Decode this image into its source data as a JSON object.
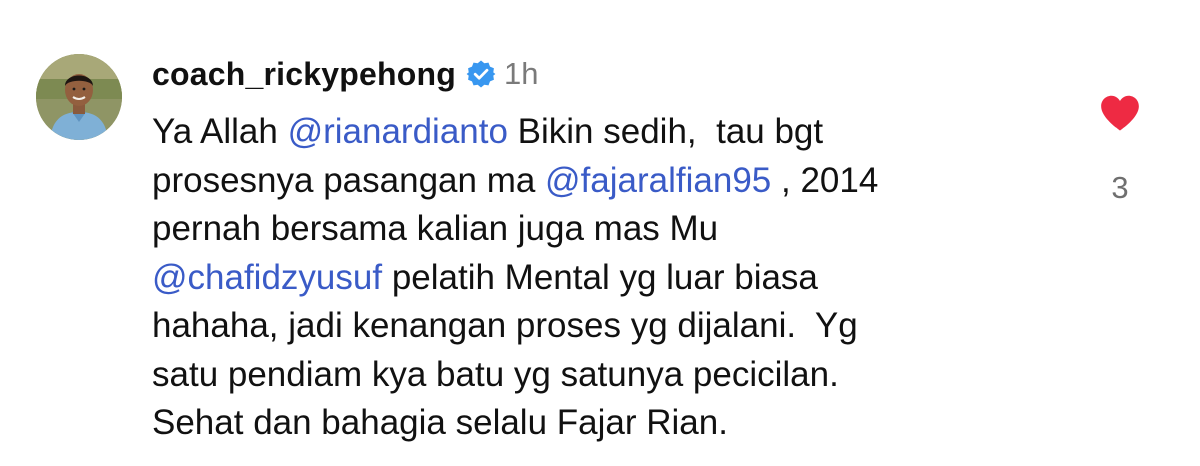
{
  "comment": {
    "username": "coach_rickypehong",
    "verified": true,
    "time": "1h",
    "body": {
      "line1": {
        "pre": "Ya Allah ",
        "mention": "@rianardianto",
        "post": " Bikin sedih,  tau bgt"
      },
      "line2": {
        "pre": "prosesnya pasangan ma ",
        "mention": "@fajaralfian95",
        "post": " , 2014"
      },
      "line3": "pernah bersama kalian juga mas Mu",
      "line4": {
        "mention": "@chafidzyusuf",
        "post": " pelatih Mental yg luar biasa"
      },
      "line5": "hahaha, jadi kenangan proses yg dijalani.  Yg",
      "line6": "satu pendiam kya batu yg satunya pecicilan.",
      "line7": "Sehat dan bahagia selalu Fajar Rian."
    },
    "likes": {
      "count": "3",
      "liked": true
    }
  },
  "icons": {
    "verified": "verified-badge-icon",
    "like": "heart-icon"
  },
  "colors": {
    "mention": "#3a5bc7",
    "heart": "#ee2a43",
    "verified": "#3897f0",
    "muted": "#7a7a7a"
  }
}
